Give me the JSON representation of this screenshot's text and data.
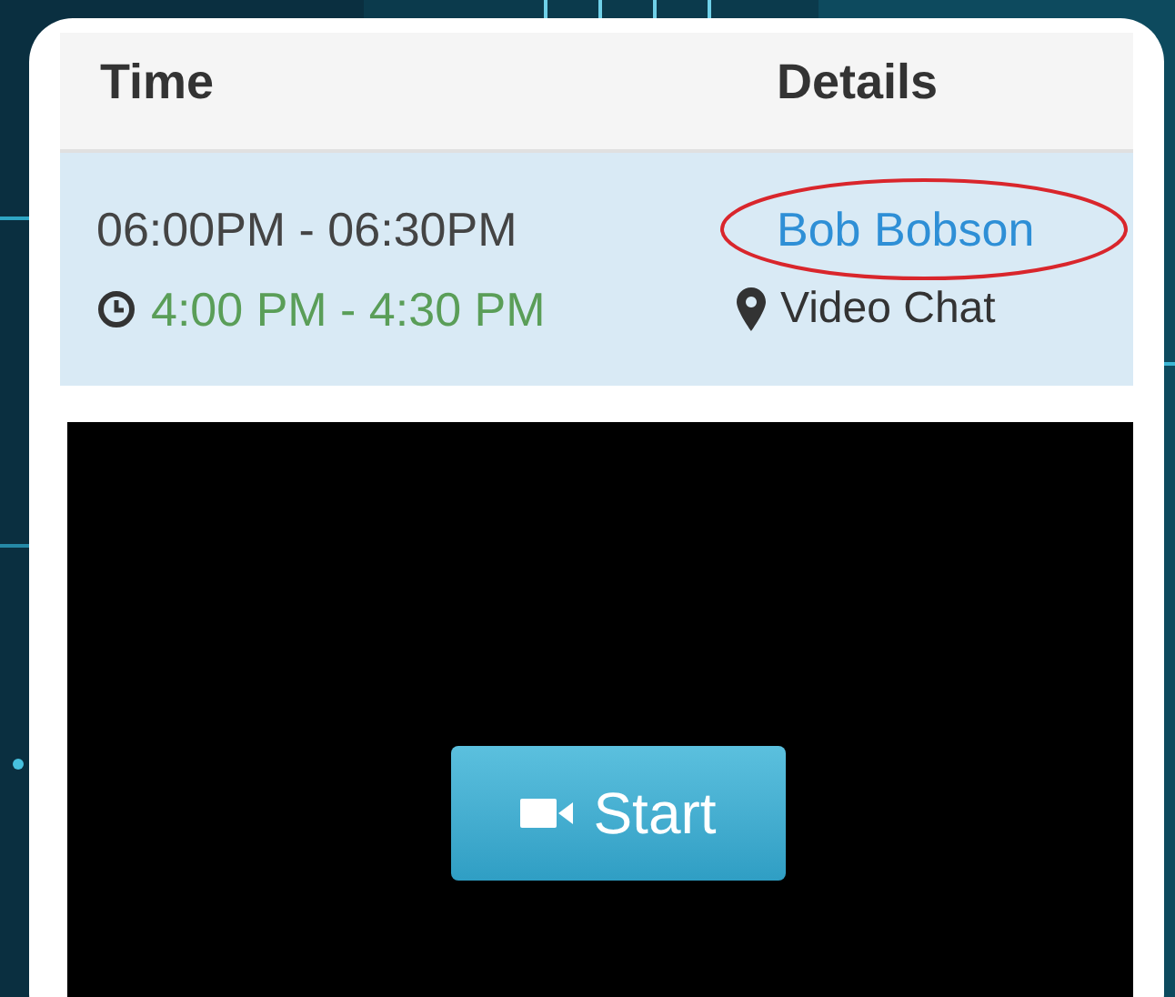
{
  "table": {
    "columns": [
      "Time",
      "Details"
    ],
    "rows": [
      {
        "time": "06:00PM - 06:30PM",
        "local_time": "4:00 PM - 4:30 PM",
        "name": "Bob Bobson",
        "location": "Video Chat",
        "circled": true
      }
    ]
  },
  "video": {
    "button": "Start"
  }
}
